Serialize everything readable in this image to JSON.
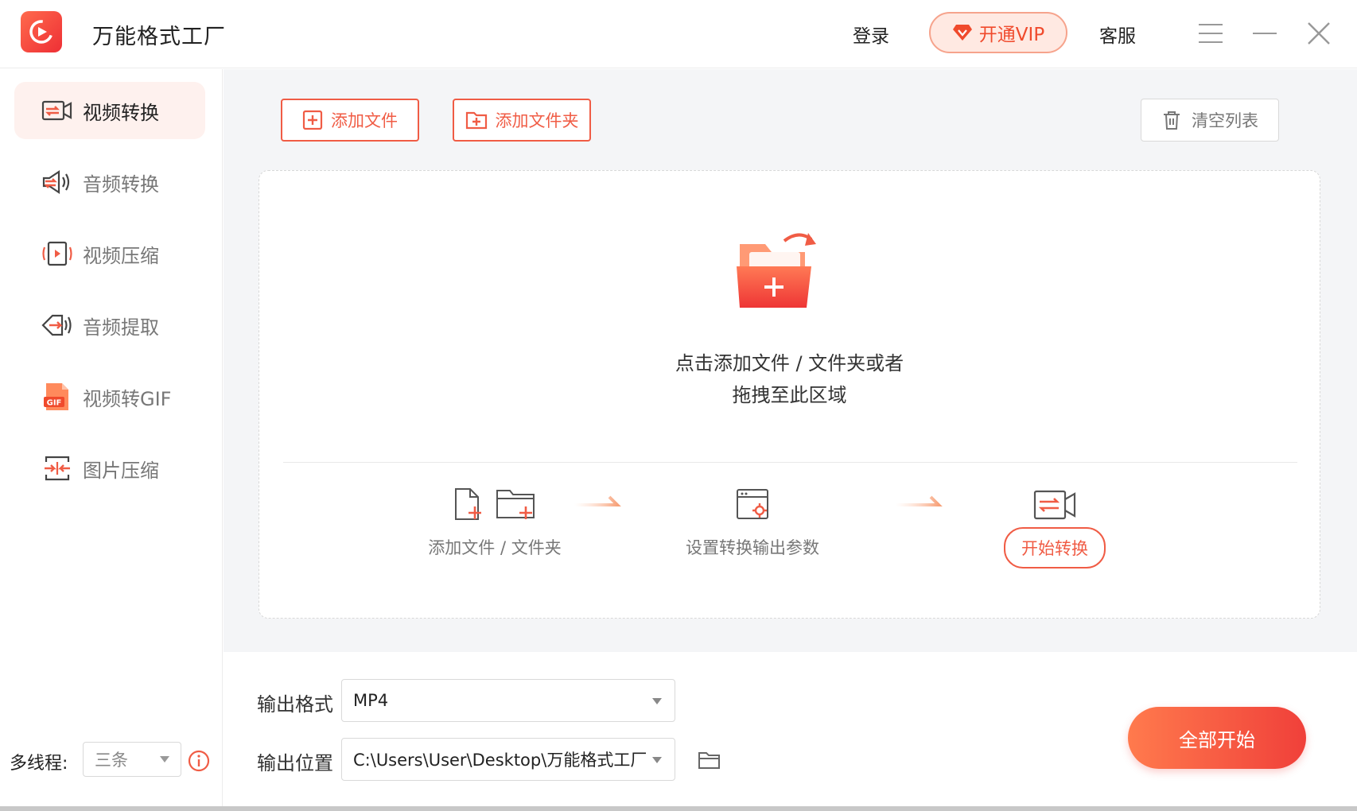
{
  "app": {
    "title": "万能格式工厂"
  },
  "titlebar": {
    "login": "登录",
    "vip": "开通VIP",
    "service": "客服"
  },
  "sidebar": {
    "items": [
      {
        "label": "视频转换",
        "icon": "video-convert-icon",
        "active": true
      },
      {
        "label": "音频转换",
        "icon": "audio-convert-icon"
      },
      {
        "label": "视频压缩",
        "icon": "video-compress-icon"
      },
      {
        "label": "音频提取",
        "icon": "audio-extract-icon"
      },
      {
        "label": "视频转GIF",
        "icon": "gif-icon"
      },
      {
        "label": "图片压缩",
        "icon": "image-compress-icon"
      }
    ],
    "threads_label": "多线程:",
    "threads_value": "三条"
  },
  "toolbar": {
    "add_file": "添加文件",
    "add_folder": "添加文件夹",
    "clear_list": "清空列表"
  },
  "dropzone": {
    "line1": "点击添加文件 / 文件夹或者",
    "line2": "拖拽至此区域",
    "steps": [
      {
        "label": "添加文件 / 文件夹"
      },
      {
        "label": "设置转换输出参数"
      },
      {
        "label": "开始转换"
      }
    ]
  },
  "output": {
    "format_label": "输出格式",
    "format_value": "MP4",
    "location_label": "输出位置",
    "location_value": "C:\\Users\\User\\Desktop\\万能格式工厂\\"
  },
  "actions": {
    "start_all": "全部开始"
  },
  "colors": {
    "accent": "#f05c45",
    "accent_gradient_start": "#ff7a4d",
    "accent_gradient_end": "#f0403a",
    "sidebar_active_bg": "#fef1ee"
  }
}
